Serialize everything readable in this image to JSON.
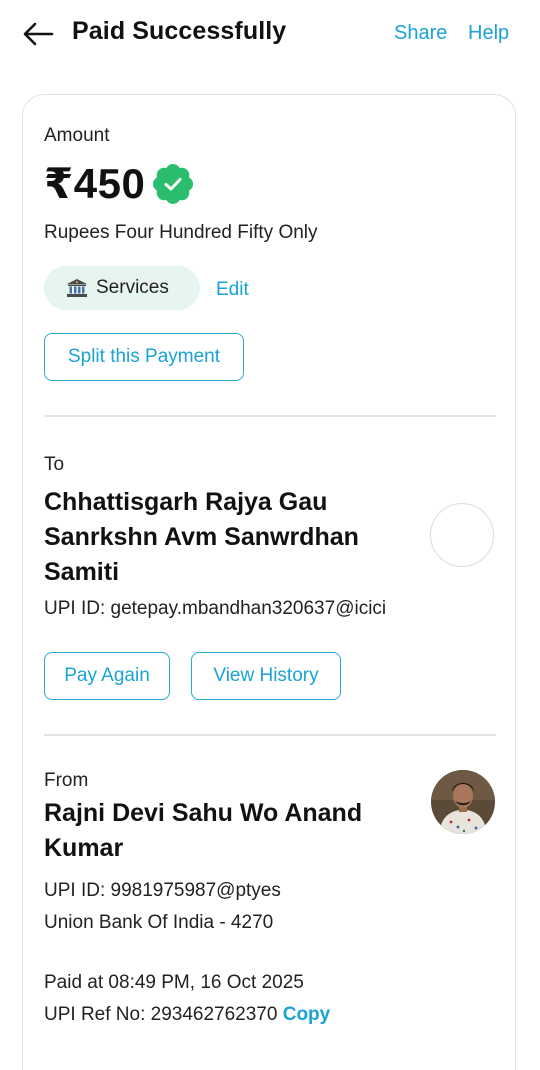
{
  "header": {
    "title": "Paid Successfully",
    "share_label": "Share",
    "help_label": "Help"
  },
  "amount_section": {
    "label": "Amount",
    "amount": "₹450",
    "amount_words": "Rupees Four Hundred Fifty Only",
    "category_label": "Services",
    "edit_label": "Edit",
    "split_label": "Split this Payment"
  },
  "to_section": {
    "label": "To",
    "name_line1": "Chhattisgarh Rajya Gau",
    "name_line2": "Sanrkshn Avm Sanwrdhan",
    "name_line3": "Samiti",
    "upi_id": "UPI ID: getepay.mbandhan320637@icici",
    "pay_again_label": "Pay Again",
    "view_history_label": "View History"
  },
  "from_section": {
    "label": "From",
    "name_line1": "Rajni Devi Sahu Wo Anand",
    "name_line2": "Kumar",
    "upi_id": "UPI ID: 9981975987@ptyes",
    "bank": "Union Bank Of India - 4270",
    "paid_at": "Paid at 08:49 PM, 16 Oct 2025",
    "ref_no": "UPI Ref No: 293462762370",
    "copy_label": "Copy"
  },
  "colors": {
    "accent": "#1aa3d4",
    "success_green": "#2bbd6e",
    "chip_bg": "#e6f6ef"
  },
  "icons": {
    "back": "arrow-left-icon",
    "verified": "verified-badge-icon",
    "category": "bank-icon"
  }
}
